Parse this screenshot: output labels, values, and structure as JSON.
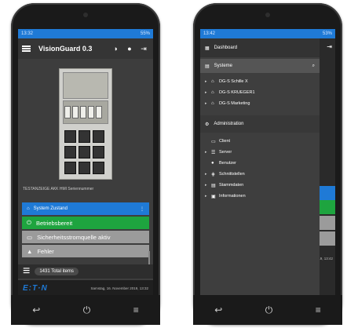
{
  "left": {
    "statusbar": {
      "time": "13:32",
      "right": "55%"
    },
    "appbar": {
      "title": "VisionGuard 0.3"
    },
    "cabinet_label": "TESTANZEIGE AKK   HMI Seriennummer",
    "status_panel": {
      "header": "System Zustand",
      "rows": [
        "Betriebsbereit",
        "Sicherheitsstromquelle aktiv",
        "Fehler"
      ]
    },
    "total": "1431 Total items",
    "footer": {
      "brand": "E:T·N",
      "timestamp": "Samstag, 16. November 2019, 13:32"
    },
    "colors": {
      "accent": "#1f7ad6",
      "ok": "#1ea43f",
      "inactive": "#9b9b9b"
    }
  },
  "right": {
    "statusbar": {
      "time": "13:42",
      "right": "53%"
    },
    "dashboard": "Dashboard",
    "systeme": "Systeme",
    "systems": [
      "DG-S Schille X",
      "DG-S KRUEGER1",
      "DG-S Marketing"
    ],
    "administration": "Administration",
    "admin_items": [
      "Client",
      "Server",
      "Benutzer",
      "Schnittstellen",
      "Stammdaten",
      "Informationen"
    ],
    "time_hint": "19, 13:42"
  },
  "icons": [
    "menu-icon",
    "contrast-icon",
    "account-icon",
    "exit-icon",
    "search-icon",
    "gear-icon",
    "home-icon",
    "back-icon",
    "power-icon",
    "recent-icon"
  ]
}
